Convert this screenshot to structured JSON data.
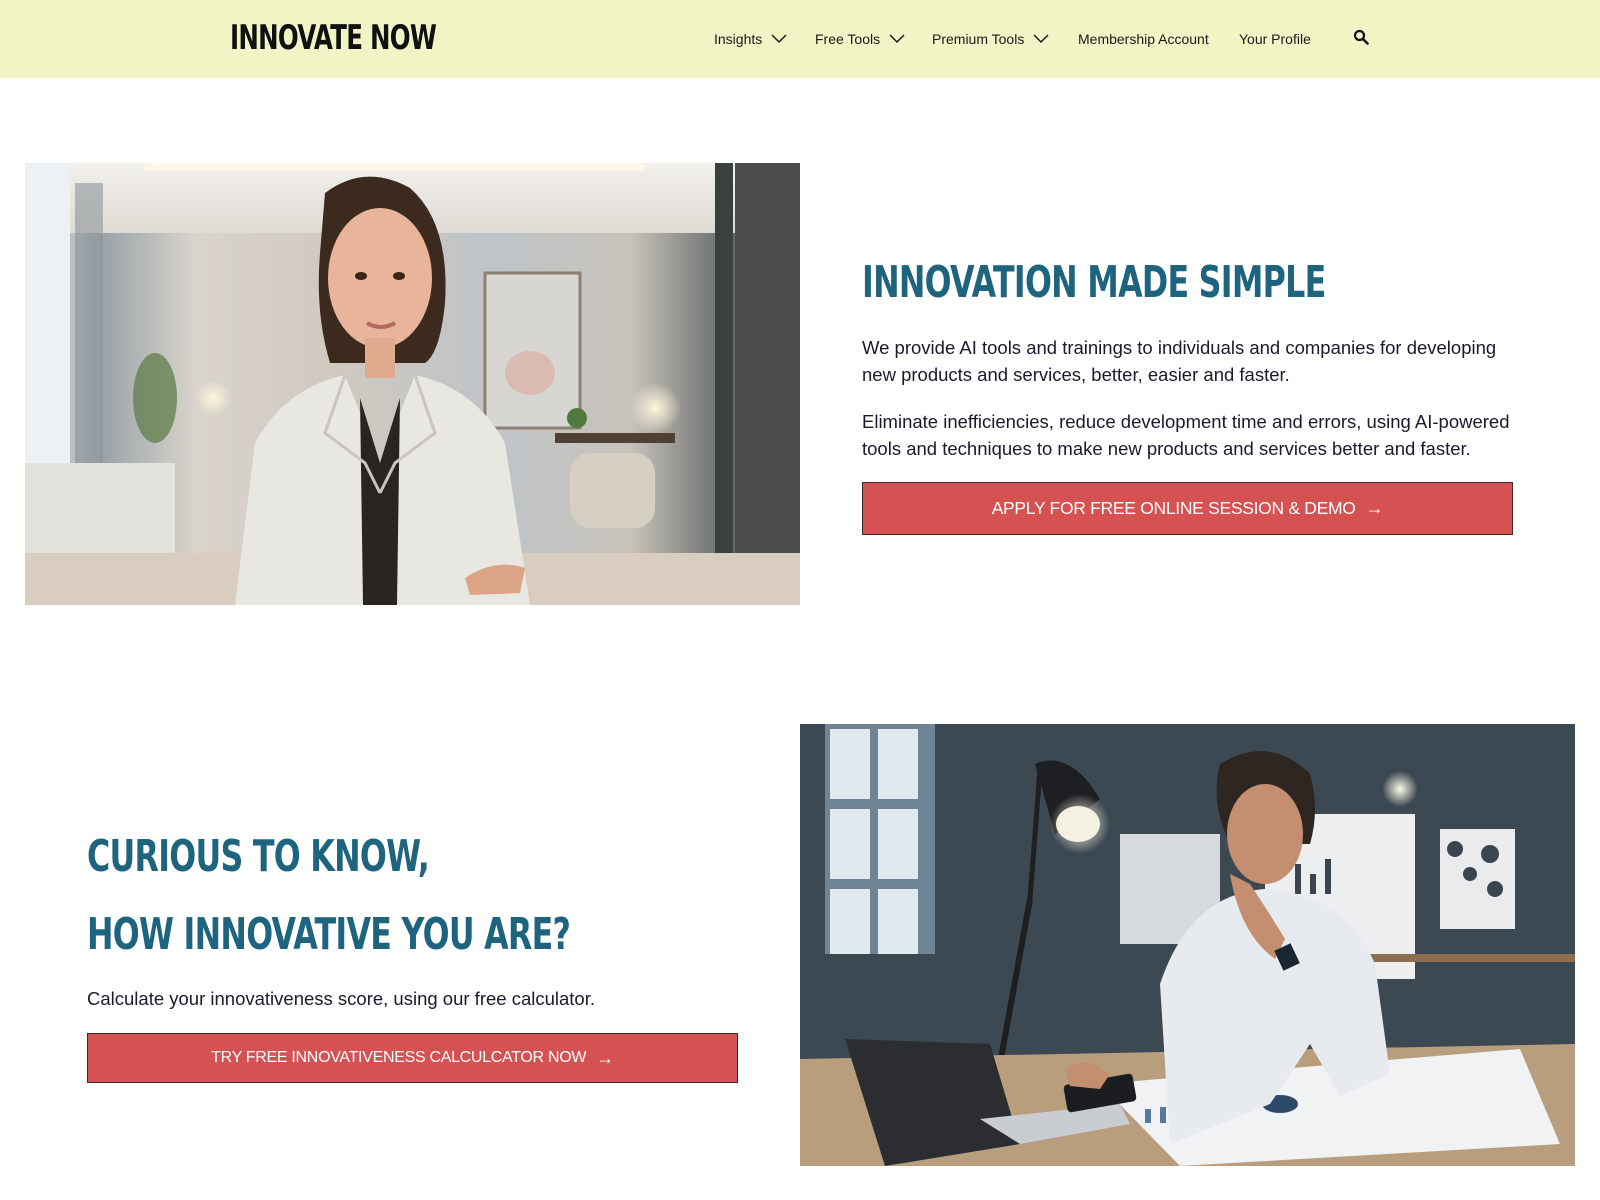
{
  "header": {
    "logo": "INNOVATE NOW",
    "background": "#f1f5c6",
    "nav": [
      {
        "label": "Insights",
        "has_dropdown": true
      },
      {
        "label": "Free Tools",
        "has_dropdown": true
      },
      {
        "label": "Premium Tools",
        "has_dropdown": true
      },
      {
        "label": "Membership Account",
        "has_dropdown": false
      },
      {
        "label": "Your Profile",
        "has_dropdown": false
      }
    ],
    "search_icon": "search-icon"
  },
  "hero": {
    "image_alt": "Smiling businesswoman in a light blazer in a modern bright living room",
    "title": "INNOVATION MADE SIMPLE",
    "paragraph_1": "We provide AI tools and trainings to individuals and companies for developing new products and services, better, easier and faster.",
    "paragraph_2": "Eliminate inefficiencies, reduce development time and errors, using AI-powered tools and techniques to make new products and services better and faster.",
    "cta_label": "APPLY FOR FREE ONLINE SESSION & DEMO",
    "cta_icon": "→"
  },
  "calculator": {
    "title_line_1": "CURIOUS TO KNOW,",
    "title_line_2": "HOW INNOVATIVE YOU ARE?",
    "description": "Calculate your innovativeness score, using our free calculator.",
    "cta_label": "TRY FREE INNOVATIVENESS CALCULCATOR NOW",
    "cta_icon": "→",
    "image_alt": "Thoughtful man in white shirt at desk with laptop, calculator and lamp in industrial office"
  },
  "colors": {
    "accent_heading": "#1e647f",
    "cta_background": "#d65152",
    "cta_text": "#ffffff",
    "header_background": "#f1f5c6"
  }
}
